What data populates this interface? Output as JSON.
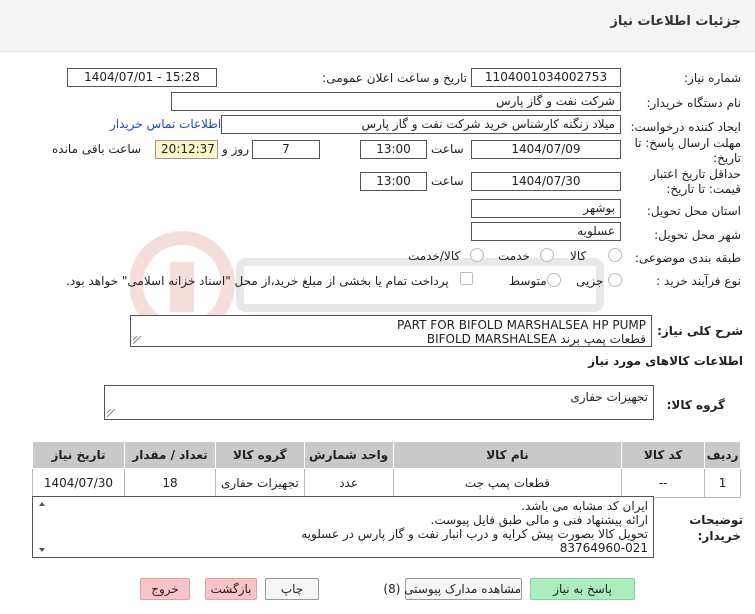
{
  "header": {
    "title": "جزئیات اطلاعات نیاز"
  },
  "form": {
    "need_number_label": "شماره نیاز:",
    "need_number": "1104001034002753",
    "announce_label": "تاریخ و ساعت اعلان عمومی:",
    "announce_value": "1404/07/01 - 15:28",
    "buyer_org_label": "نام دستگاه خریدار:",
    "buyer_org": "شرکت نفت و گاز پارس",
    "creator_label": "ایجاد کننده درخواست:",
    "creator": "میلاد زنگنه کارشناس خرید شرکت نفت و گاز پارس",
    "contact_link": "اطلاعات تماس خریدار",
    "deadline_label_1": "مهلت ارسال پاسخ: تا",
    "deadline_label_2": "تاریخ:",
    "deadline_date": "1404/07/09",
    "time_label": "ساعت",
    "deadline_time": "13:00",
    "days_value": "7",
    "days_label": "روز و",
    "remaining_time": "20:12:37",
    "remaining_label": "ساعت باقی مانده",
    "validity_label_1": "حداقل تاریخ اعتبار",
    "validity_label_2": "قیمت: تا تاریخ:",
    "validity_date": "1404/07/30",
    "validity_time_label": "ساعت",
    "validity_time": "13:00",
    "province_label": "استان محل تحویل:",
    "province": "بوشهر",
    "city_label": "شهر محل تحویل:",
    "city": "عسلویه",
    "category_label": "طبقه بندی موضوعی:",
    "category_options": [
      "کالا",
      "خدمت",
      "کالا/خدمت"
    ],
    "process_label": "نوع فرآیند خرید :",
    "process_options": [
      "جزیی",
      "متوسط"
    ],
    "payment_note": "پرداخت تمام یا بخشی از مبلغ خرید،از محل \"اسناد خزانه اسلامی\" خواهد بود."
  },
  "description": {
    "label": "شرح کلی نیاز:",
    "line1": "PART FOR BIFOLD MARSHALSEA HP PUMP",
    "line2": "قطعات پمپ برند BIFOLD MARSHALSEA"
  },
  "goods_section": {
    "title": "اطلاعات کالاهای مورد نیاز"
  },
  "goods_group": {
    "label": "گروه کالا:",
    "value": "تجهیزات حفاری"
  },
  "table": {
    "headers": [
      "ردیف",
      "کد کالا",
      "نام کالا",
      "واحد شمارش",
      "گروه کالا",
      "تعداد / مقدار",
      "تاریخ نیاز"
    ],
    "rows": [
      [
        "1",
        "--",
        "قطعات پمپ جت",
        "عدد",
        "تجهیزات حفاری",
        "18",
        "1404/07/30"
      ]
    ]
  },
  "buyer_notes": {
    "label_1": "توضیحات",
    "label_2": "خریدار:",
    "lines": [
      "ایران کد مشابه می باشد.",
      "ارائه پیشنهاد فنی و مالی طبق فایل پیوست.",
      "تحویل کالا بصورت پیش کرایه و درب انبار نفت و گاز پارس در عسلویه",
      "83764960-021"
    ]
  },
  "buttons": {
    "reply": "پاسخ به نیاز",
    "docs": "مشاهده مدارک پیوستی (8)",
    "print": "چاپ",
    "back": "بازگشت",
    "exit": "خروج"
  },
  "colors": {
    "header_bg": "#f4f4f4",
    "timer_bg": "#fdf5c9",
    "link": "#1a4fb5",
    "table_header_bg": "#c9c9c9",
    "green_button": "#a9eebc",
    "pink_button": "#f7c4c8"
  }
}
